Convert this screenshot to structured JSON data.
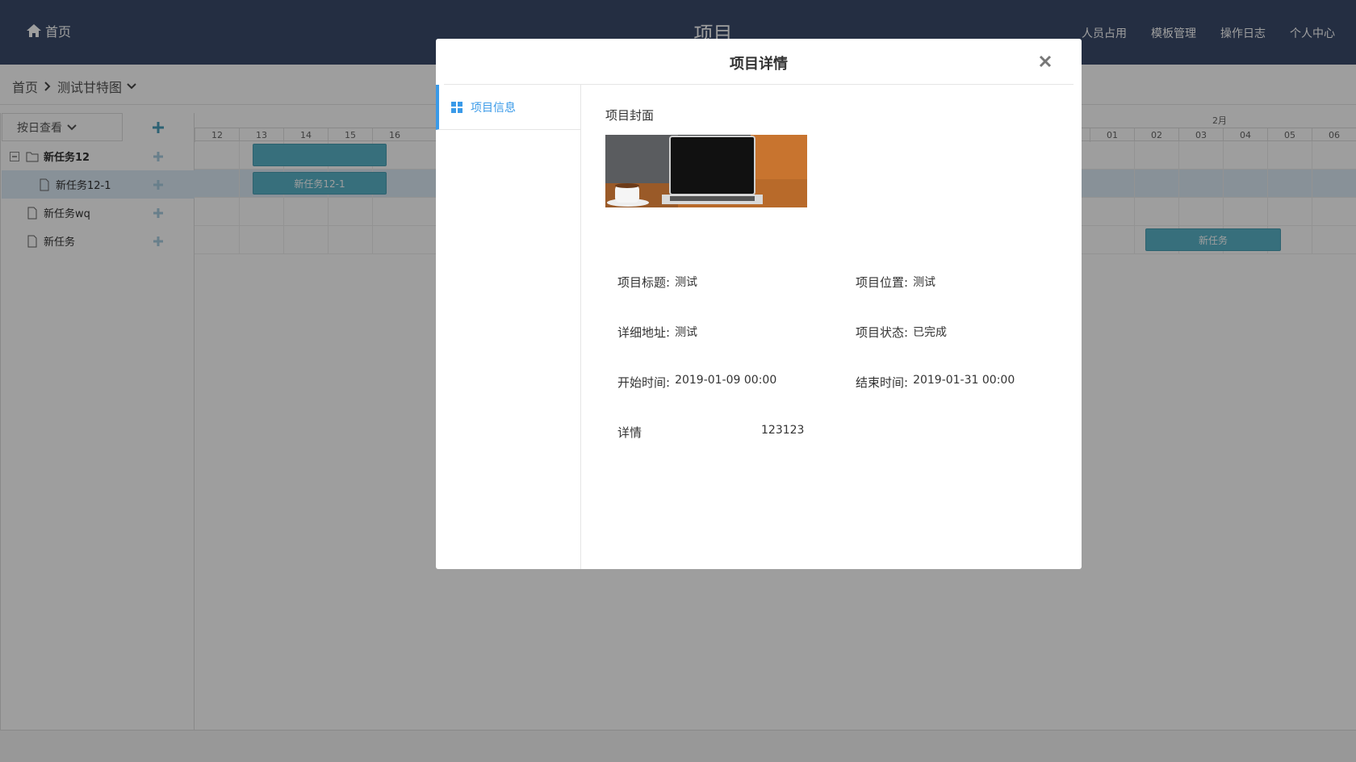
{
  "topbar": {
    "home_label": "首页",
    "app_title": "项目",
    "nav": [
      "人员占用",
      "模板管理",
      "操作日志",
      "个人中心"
    ]
  },
  "breadcrumb": {
    "home": "首页",
    "current": "测试甘特图"
  },
  "leftpanel": {
    "view_select": "按日查看",
    "tasks": [
      {
        "label": "新任务12",
        "type": "folder",
        "expanded": true
      },
      {
        "label": "新任务12-1",
        "type": "file",
        "selected": true
      },
      {
        "label": "新任务wq",
        "type": "file"
      },
      {
        "label": "新任务",
        "type": "file"
      }
    ]
  },
  "gantt": {
    "month_label": "2月",
    "days_left": [
      "12",
      "13",
      "14",
      "15",
      "16"
    ],
    "days_right": [
      "01",
      "02",
      "03",
      "04",
      "05",
      "06"
    ],
    "bars": [
      {
        "row": 0,
        "label": ""
      },
      {
        "row": 1,
        "label": "新任务12-1"
      },
      {
        "row": 3,
        "label": "新任务"
      }
    ]
  },
  "modal": {
    "title": "项目详情",
    "side_tab": "项目信息",
    "cover_label": "项目封面",
    "fields": {
      "title_label": "项目标题:",
      "title_value": "测试",
      "location_label": "项目位置:",
      "location_value": "测试",
      "address_label": "详细地址:",
      "address_value": "测试",
      "status_label": "项目状态:",
      "status_value": "已完成",
      "start_label": "开始时间:",
      "start_value": "2019-01-09 00:00",
      "end_label": "结束时间:",
      "end_value": "2019-01-31 00:00",
      "detail_label": "详情",
      "detail_value": "123123"
    }
  },
  "colors": {
    "navbar": "#3a4b6b",
    "accent": "#3a9ae8",
    "bar": "#5ab4c9",
    "selected_row": "#dbeaf6"
  }
}
